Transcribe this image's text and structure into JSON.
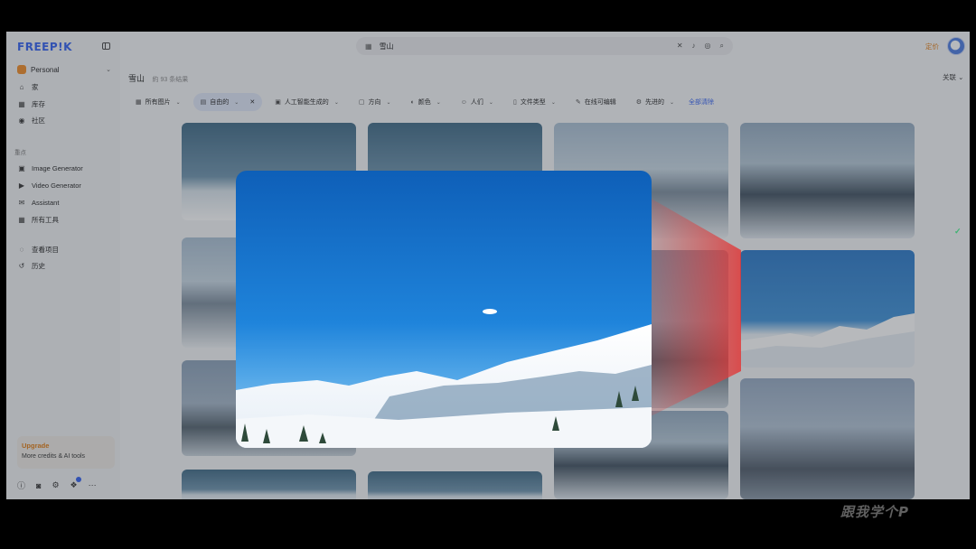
{
  "app": {
    "logo": "FREEP!K",
    "workspace": "Personal"
  },
  "sidebar": {
    "nav": [
      {
        "icon": "home-icon",
        "glyph": "⌂",
        "label": "家"
      },
      {
        "icon": "library-icon",
        "glyph": "▦",
        "label": "库存"
      },
      {
        "icon": "community-icon",
        "glyph": "◉",
        "label": "社区"
      }
    ],
    "section": "重点",
    "tools": [
      {
        "icon": "image-generator-icon",
        "glyph": "▣",
        "label": "Image Generator"
      },
      {
        "icon": "video-generator-icon",
        "glyph": "▶",
        "label": "Video Generator"
      },
      {
        "icon": "assistant-icon",
        "glyph": "✉",
        "label": "Assistant"
      },
      {
        "icon": "all-tools-icon",
        "glyph": "▦",
        "label": "所有工具"
      }
    ],
    "more": [
      {
        "icon": "projects-icon",
        "glyph": "◌",
        "label": "查看项目"
      },
      {
        "icon": "history-icon",
        "glyph": "↺",
        "label": "历史"
      }
    ],
    "upgrade": {
      "title": "Upgrade",
      "subtitle": "More credits & AI tools"
    }
  },
  "header": {
    "search_value": "雪山",
    "pricing": "定价"
  },
  "results": {
    "title": "雪山",
    "count": "約 93 条结果",
    "sort": "关联"
  },
  "filters": [
    {
      "label": "所有图片",
      "icon": "image-icon",
      "glyph": "▦"
    },
    {
      "label": "自由的",
      "icon": "doc-icon",
      "glyph": "▤",
      "active": true
    },
    {
      "label": "人工智能生成的",
      "icon": "ai-icon",
      "glyph": "▣"
    },
    {
      "label": "方向",
      "icon": "orientation-icon",
      "glyph": "▢"
    },
    {
      "label": "颜色",
      "icon": "palette-icon",
      "glyph": "◐"
    },
    {
      "label": "人们",
      "icon": "people-icon",
      "glyph": "☺"
    },
    {
      "label": "文件类型",
      "icon": "file-icon",
      "glyph": "▯"
    },
    {
      "label": "在线可编辑",
      "icon": "edit-icon",
      "glyph": "✎"
    },
    {
      "label": "先进的",
      "icon": "advanced-icon",
      "glyph": "⚙"
    }
  ],
  "clear_all": "全部清除",
  "watermark": "跟我学个P"
}
